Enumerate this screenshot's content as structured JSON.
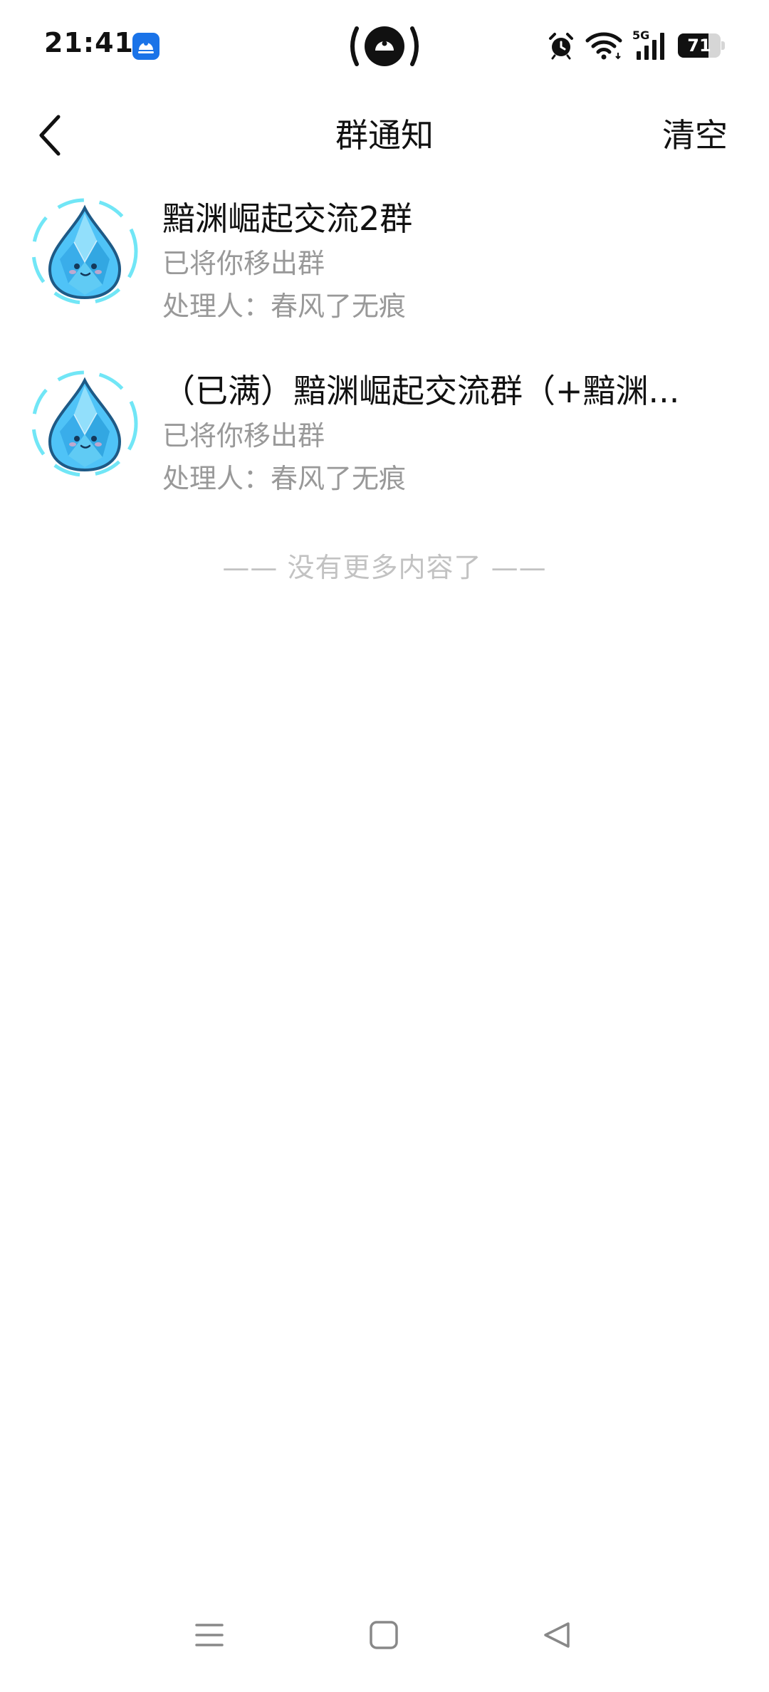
{
  "status_bar": {
    "time": "21:41",
    "network_label": "5G",
    "battery_level": "71",
    "battery_percent": 71,
    "icons": [
      "app-notification-icon",
      "hotspot-icon",
      "alarm-icon",
      "wifi-icon",
      "signal-icon",
      "battery-icon"
    ]
  },
  "header": {
    "title": "群通知",
    "clear_label": "清空",
    "back_icon": "chevron-left-icon"
  },
  "notifications": [
    {
      "group_name": "黯渊崛起交流2群",
      "message": "已将你移出群",
      "handler": "处理人：春风了无痕",
      "avatar_icon": "water-drop-crystal-icon"
    },
    {
      "group_name": "（已满）黯渊崛起交流群（+黯渊...",
      "message": "已将你移出群",
      "handler": "处理人：春风了无痕",
      "avatar_icon": "water-drop-crystal-icon"
    }
  ],
  "list_footer": "—— 没有更多内容了 ——",
  "nav_bar": {
    "icons": [
      "menu-icon",
      "home-icon",
      "back-triangle-icon"
    ]
  },
  "colors": {
    "primary_text": "#111111",
    "secondary_text": "#999999",
    "footer_text": "#c2c2c2",
    "avatar_blue": "#4fc3f7",
    "app_icon_blue": "#1a73e8"
  }
}
